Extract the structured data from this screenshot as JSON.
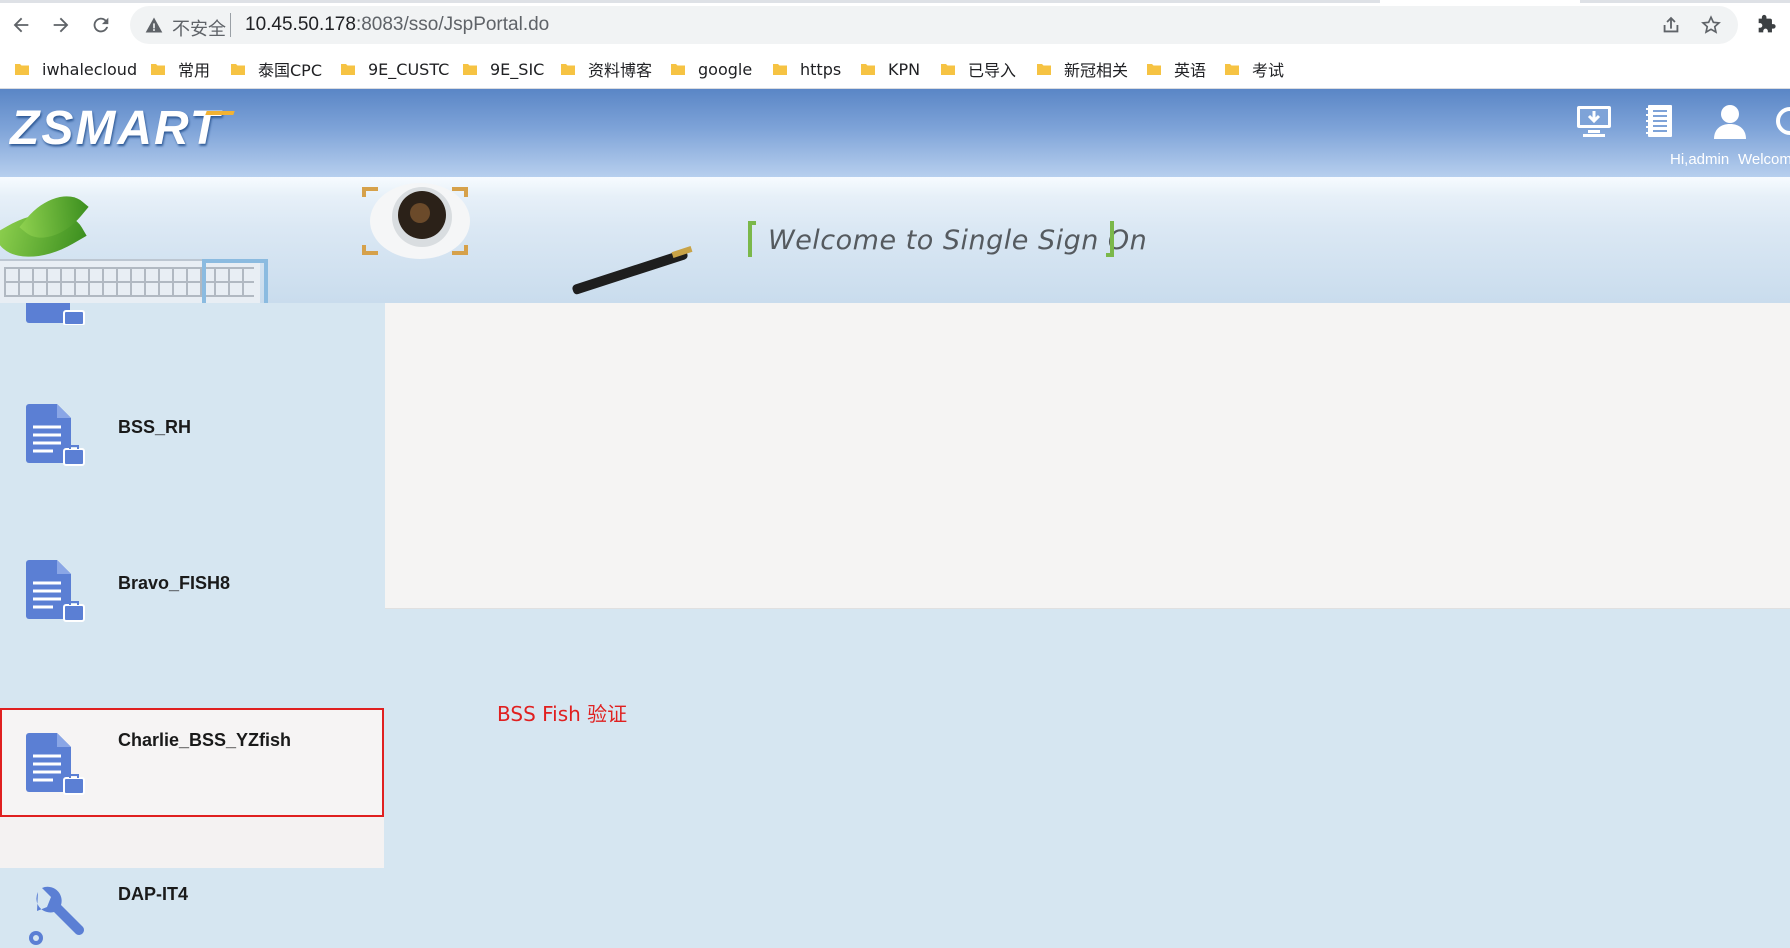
{
  "browser": {
    "security_label": "不安全",
    "url_host": "10.45.50.178",
    "url_port_path": ":8083/sso/JspPortal.do",
    "bookmarks": [
      {
        "label": "iwhalecloud"
      },
      {
        "label": "常用"
      },
      {
        "label": "泰国CPC"
      },
      {
        "label": "9E_CUSTC"
      },
      {
        "label": "9E_SIC"
      },
      {
        "label": "资料博客"
      },
      {
        "label": "google"
      },
      {
        "label": "https"
      },
      {
        "label": "KPN"
      },
      {
        "label": "已导入"
      },
      {
        "label": "新冠相关"
      },
      {
        "label": "英语"
      },
      {
        "label": "考试"
      }
    ]
  },
  "header": {
    "logo": "ZSMART",
    "user_label": "Hi,admin",
    "welcome_label": "Welcom",
    "icons": [
      "download-monitor-icon",
      "notebook-icon",
      "user-icon",
      "logout-icon"
    ]
  },
  "banner": {
    "welcome_text": "Welcome to Single Sign On"
  },
  "sidebar": {
    "items": [
      {
        "name": "BSS_RH",
        "icon": "document-icon"
      },
      {
        "name": "Bravo_FISH8",
        "icon": "document-icon"
      },
      {
        "name": "Charlie_BSS_YZfish",
        "icon": "document-icon"
      },
      {
        "name": "DAP-IT4",
        "icon": "wrench-icon"
      }
    ]
  },
  "annotation": {
    "text": "BSS Fish 验证",
    "color": "#e02020"
  },
  "colors": {
    "header_blue": "#5a86c6",
    "sidebar_bg": "#d6e6f1",
    "icon_blue": "#5b7fd4",
    "highlight_red": "#e02020"
  }
}
